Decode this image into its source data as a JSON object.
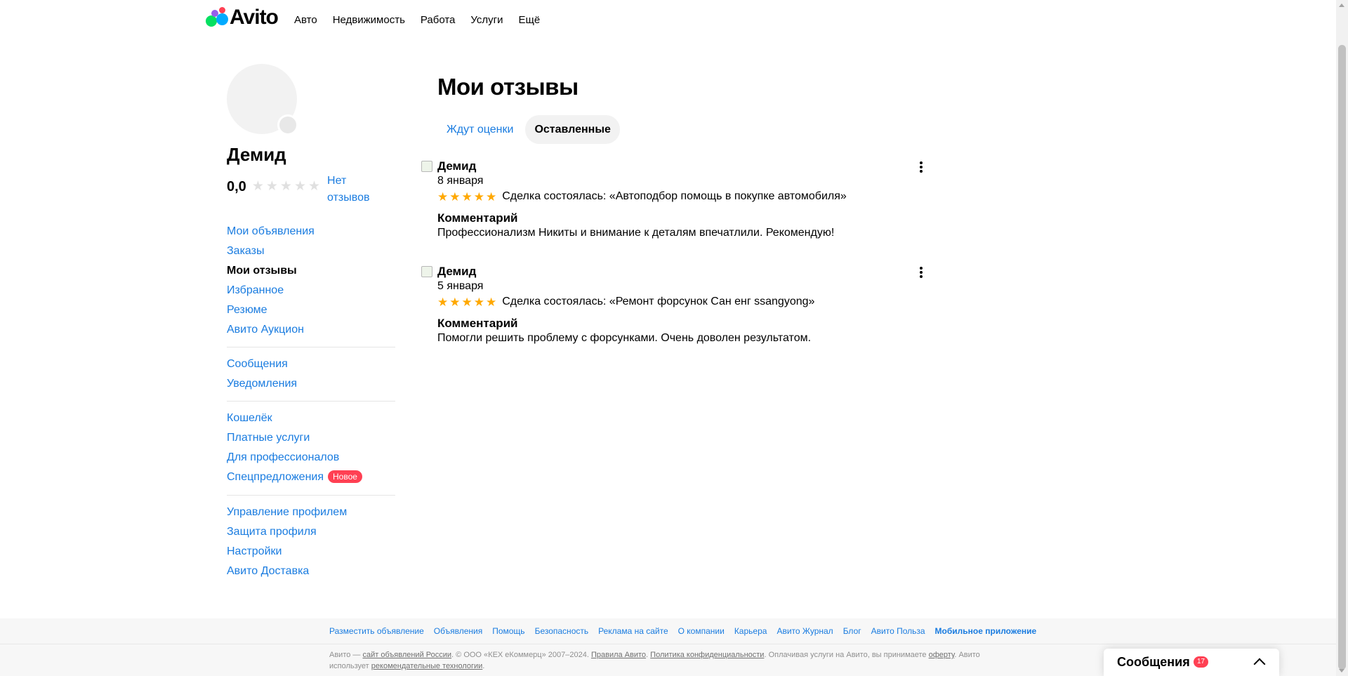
{
  "header": {
    "logo_text": "Avito",
    "nav": [
      "Авто",
      "Недвижимость",
      "Работа",
      "Услуги",
      "Ещё"
    ]
  },
  "profile": {
    "name": "Демид",
    "rating": "0,0",
    "no_reviews": "Нет отзывов"
  },
  "sidebar": {
    "group1": [
      {
        "label": "Мои объявления"
      },
      {
        "label": "Заказы"
      },
      {
        "label": "Мои отзывы"
      },
      {
        "label": "Избранное"
      },
      {
        "label": "Резюме"
      },
      {
        "label": "Авито Аукцион"
      }
    ],
    "group2": [
      {
        "label": "Сообщения"
      },
      {
        "label": "Уведомления"
      }
    ],
    "group3": [
      {
        "label": "Кошелёк"
      },
      {
        "label": "Платные услуги"
      },
      {
        "label": "Для профессионалов"
      },
      {
        "label": "Спецпредложения",
        "badge": "Новое"
      }
    ],
    "group4": [
      {
        "label": "Управление профилем"
      },
      {
        "label": "Защита профиля"
      },
      {
        "label": "Настройки"
      },
      {
        "label": "Авито Доставка"
      }
    ]
  },
  "main": {
    "title": "Мои отзывы",
    "tabs": [
      {
        "label": "Ждут оценки",
        "active": false
      },
      {
        "label": "Оставленные",
        "active": true
      }
    ],
    "reviews": [
      {
        "author": "Демид",
        "date": "8 января",
        "stars": 5,
        "deal": "Сделка состоялась: «Автоподбор помощь в покупке автомобиля»",
        "comment_label": "Комментарий",
        "comment": "Профессионализм Никиты и внимание к деталям впечатлили. Рекомендую!"
      },
      {
        "author": "Демид",
        "date": "5 января",
        "stars": 5,
        "deal": "Сделка состоялась: «Ремонт форсунок Сан енг ssangyong»",
        "comment_label": "Комментарий",
        "comment": "Помогли решить проблему с форсунками. Очень доволен результатом."
      }
    ]
  },
  "footer": {
    "links": [
      "Разместить объявление",
      "Объявления",
      "Помощь",
      "Безопасность",
      "Реклама на сайте",
      "О компании",
      "Карьера",
      "Авито Журнал",
      "Блог",
      "Авито Польза",
      "Мобильное приложение"
    ],
    "legal": {
      "t1": "Авито — ",
      "u1": "сайт объявлений России",
      "t2": ". © ООО «КЕХ eКоммерц» 2007–2024. ",
      "u2": "Правила Авито",
      "t3": ". ",
      "u3": "Политика конфиденциальности",
      "t4": ". Оплачивая услуги на Авито, вы принимаете ",
      "u4": "оферту",
      "t5": ". Авито использует ",
      "u5": "рекомендательные технологии",
      "t6": "."
    }
  },
  "messenger": {
    "label": "Сообщения",
    "count": "17"
  },
  "colors": {
    "link": "#1a7ce0",
    "star_filled": "#ffa800",
    "star_empty": "#e0e0e0",
    "badge": "#ff4053"
  }
}
